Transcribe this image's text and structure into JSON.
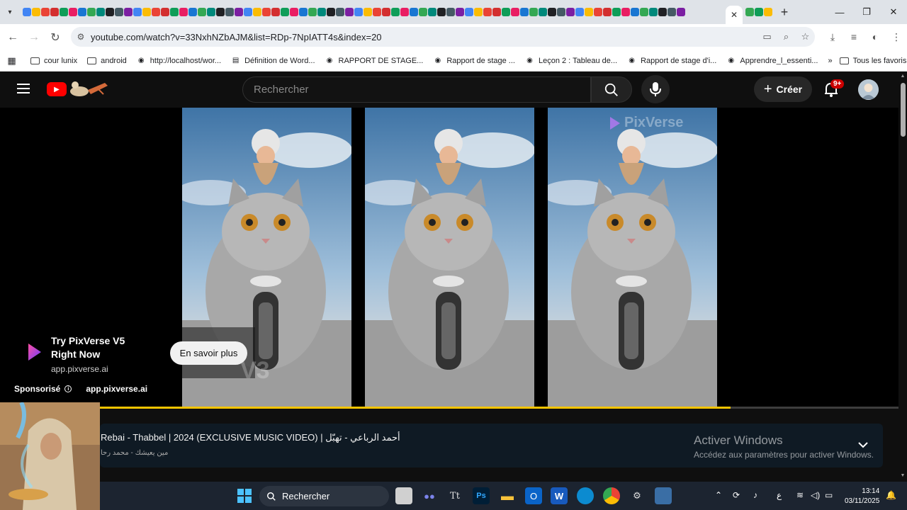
{
  "browser": {
    "url": "youtube.com/watch?v=33NxhNZbAJM&list=RDp-7NpIATT4s&index=20",
    "bookmarks": [
      {
        "label": "cour lunix",
        "icon": "folder-icon"
      },
      {
        "label": "android",
        "icon": "folder-icon"
      },
      {
        "label": "http://localhost/wor...",
        "icon": "site-icon"
      },
      {
        "label": "Définition de Word...",
        "icon": "page-icon"
      },
      {
        "label": "RAPPORT DE STAGE...",
        "icon": "site-icon"
      },
      {
        "label": "Rapport de stage ...",
        "icon": "site-icon"
      },
      {
        "label": "Leçon 2 : Tableau de...",
        "icon": "site-icon"
      },
      {
        "label": "Rapport de stage d'i...",
        "icon": "site-icon"
      },
      {
        "label": "Apprendre_l_essenti...",
        "icon": "site-icon"
      }
    ],
    "all_bookmarks": "Tous les favoris"
  },
  "youtube": {
    "search_placeholder": "Rechercher",
    "create_label": "Créer",
    "notif_badge": "9+"
  },
  "player": {
    "watermark": "PixVerse",
    "v3_tag": "V3",
    "ad_title": "Try PixVerse V5 Right Now",
    "ad_domain": "app.pixverse.ai",
    "ad_button": "En savoir plus",
    "sponsored_label": "Sponsorisé",
    "sponsored_url": "app.pixverse.ai",
    "progress": 0.79
  },
  "video": {
    "title": "Rebai - Thabbel | 2024 (EXCLUSIVE MUSIC VIDEO) | أحمد الرباعي - تهبّل",
    "channel": "مين يعيشك - محمد رحا"
  },
  "overlay": {
    "activate_title": "Activer Windows",
    "activate_sub": "Accédez aux paramètres pour activer Windows."
  },
  "taskbar": {
    "search_label": "Rechercher",
    "time": "13:14",
    "date": "03/11/2025",
    "lang": "ع"
  }
}
